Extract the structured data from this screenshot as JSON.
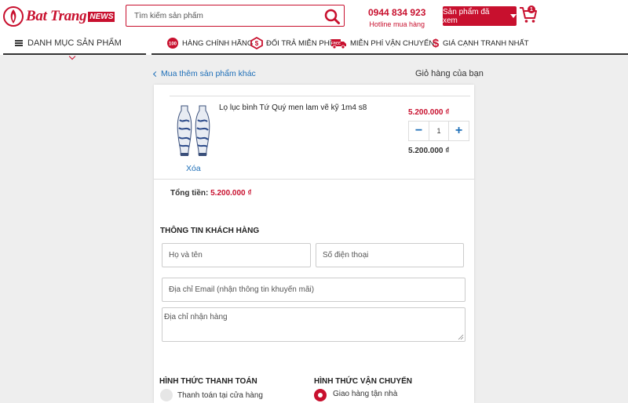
{
  "header": {
    "logo_text": "Bat Trang",
    "logo_badge": "NEWS",
    "search_placeholder": "Tìm kiếm sản phẩm",
    "hotline_number": "0944 834 923",
    "hotline_label": "Hotline mua hàng",
    "viewed_products_label": "Sản phẩm đã xem",
    "cart_count": "1",
    "brand_color": "#c8102e"
  },
  "nav": {
    "category_menu_label": "DANH MỤC SẢN PHẨM",
    "features": [
      {
        "icon": "genuine-badge-icon",
        "label": "HÀNG CHÍNH HÃNG"
      },
      {
        "icon": "return-icon",
        "label": "ĐỔI TRẢ MIỄN PHÍ"
      },
      {
        "icon": "free-shipping-truck-icon",
        "label": "MIỄN PHÍ VẬN CHUYỂN"
      },
      {
        "icon": "dollar-icon",
        "label": "GIÁ CẠNH TRANH NHẤT"
      }
    ]
  },
  "cart": {
    "back_link": "Mua thêm sản phẩm khác",
    "title": "Giỏ hàng của bạn",
    "item": {
      "name": "Lọ lục bình Tứ Quý men lam vẽ kỹ 1m4 s8",
      "price": "5.200.000 ₫",
      "quantity": "1",
      "line_total": "5.200.000 ₫",
      "remove_label": "Xóa"
    },
    "total_label": "Tổng tiền:",
    "total_value": "5.200.000 ₫"
  },
  "customer": {
    "section_title": "THÔNG TIN KHÁCH HÀNG",
    "name_placeholder": "Họ và tên",
    "phone_placeholder": "Số điện thoại",
    "email_placeholder": "Địa chỉ Email (nhận thông tin khuyến mãi)",
    "address_placeholder": "Địa chỉ nhận hàng"
  },
  "payment": {
    "section_title": "HÌNH THỨC THANH TOÁN",
    "options": [
      {
        "label": "Thanh toán tại cửa hàng",
        "selected": false
      }
    ]
  },
  "shipping": {
    "section_title": "HÌNH THỨC VẬN CHUYỂN",
    "options": [
      {
        "label": "Giao hàng tận nhà",
        "selected": true
      }
    ]
  }
}
